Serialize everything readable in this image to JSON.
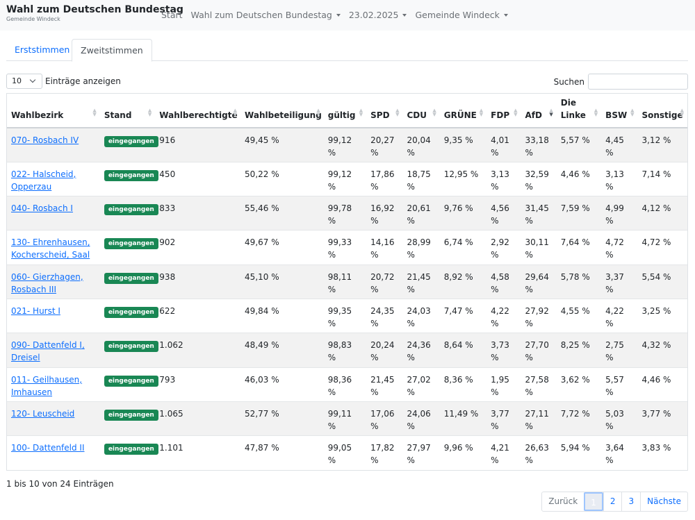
{
  "navbar": {
    "title": "Wahl zum Deutschen Bundestag",
    "subtitle": "Gemeinde Windeck",
    "links": [
      "Start",
      "Wahl zum Deutschen Bundestag",
      "23.02.2025",
      "Gemeinde Windeck"
    ]
  },
  "tabs": [
    "Erststimmen",
    "Zweitstimmen"
  ],
  "active_tab": "Zweitstimmen",
  "length_control": {
    "value": "10",
    "label": "Einträge anzeigen"
  },
  "search": {
    "label": "Suchen",
    "value": ""
  },
  "table": {
    "columns": [
      "Wahlbezirk",
      "Stand",
      "Wahlberechtigte",
      "Wahlbeteiligung",
      "gültig",
      "SPD",
      "CDU",
      "GRÜNE",
      "FDP",
      "AfD",
      "Die Linke",
      "BSW",
      "Sonstige"
    ],
    "sorted_column": "AfD",
    "sort_direction": "descending",
    "rows": [
      {
        "bezirk": "070- Rosbach IV",
        "stand": "eingegangen",
        "berechtigte": "916",
        "beteiligung": "49,45 %",
        "gueltig": "99,12 %",
        "spd": "20,27 %",
        "cdu": "20,04 %",
        "gruene": "9,35 %",
        "fdp": "4,01 %",
        "afd": "33,18 %",
        "linke": "5,57 %",
        "bsw": "4,45 %",
        "sonstige": "3,12 %"
      },
      {
        "bezirk": "022- Halscheid, Opperzau",
        "stand": "eingegangen",
        "berechtigte": "450",
        "beteiligung": "50,22 %",
        "gueltig": "99,12 %",
        "spd": "17,86 %",
        "cdu": "18,75 %",
        "gruene": "12,95 %",
        "fdp": "3,13 %",
        "afd": "32,59 %",
        "linke": "4,46 %",
        "bsw": "3,13 %",
        "sonstige": "7,14 %"
      },
      {
        "bezirk": "040- Rosbach I",
        "stand": "eingegangen",
        "berechtigte": "833",
        "beteiligung": "55,46 %",
        "gueltig": "99,78 %",
        "spd": "16,92 %",
        "cdu": "20,61 %",
        "gruene": "9,76 %",
        "fdp": "4,56 %",
        "afd": "31,45 %",
        "linke": "7,59 %",
        "bsw": "4,99 %",
        "sonstige": "4,12 %"
      },
      {
        "bezirk": "130- Ehrenhausen, Kocherscheid, Saal",
        "stand": "eingegangen",
        "berechtigte": "902",
        "beteiligung": "49,67 %",
        "gueltig": "99,33 %",
        "spd": "14,16 %",
        "cdu": "28,99 %",
        "gruene": "6,74 %",
        "fdp": "2,92 %",
        "afd": "30,11 %",
        "linke": "7,64 %",
        "bsw": "4,72 %",
        "sonstige": "4,72 %"
      },
      {
        "bezirk": "060- Gierzhagen, Rosbach III",
        "stand": "eingegangen",
        "berechtigte": "938",
        "beteiligung": "45,10 %",
        "gueltig": "98,11 %",
        "spd": "20,72 %",
        "cdu": "21,45 %",
        "gruene": "8,92 %",
        "fdp": "4,58 %",
        "afd": "29,64 %",
        "linke": "5,78 %",
        "bsw": "3,37 %",
        "sonstige": "5,54 %"
      },
      {
        "bezirk": "021- Hurst I",
        "stand": "eingegangen",
        "berechtigte": "622",
        "beteiligung": "49,84 %",
        "gueltig": "99,35 %",
        "spd": "24,35 %",
        "cdu": "24,03 %",
        "gruene": "7,47 %",
        "fdp": "4,22 %",
        "afd": "27,92 %",
        "linke": "4,55 %",
        "bsw": "4,22 %",
        "sonstige": "3,25 %"
      },
      {
        "bezirk": "090- Dattenfeld I, Dreisel",
        "stand": "eingegangen",
        "berechtigte": "1.062",
        "beteiligung": "48,49 %",
        "gueltig": "98,83 %",
        "spd": "20,24 %",
        "cdu": "24,36 %",
        "gruene": "8,64 %",
        "fdp": "3,73 %",
        "afd": "27,70 %",
        "linke": "8,25 %",
        "bsw": "2,75 %",
        "sonstige": "4,32 %"
      },
      {
        "bezirk": "011- Geilhausen, Imhausen",
        "stand": "eingegangen",
        "berechtigte": "793",
        "beteiligung": "46,03 %",
        "gueltig": "98,36 %",
        "spd": "21,45 %",
        "cdu": "27,02 %",
        "gruene": "8,36 %",
        "fdp": "1,95 %",
        "afd": "27,58 %",
        "linke": "3,62 %",
        "bsw": "5,57 %",
        "sonstige": "4,46 %"
      },
      {
        "bezirk": "120- Leuscheid",
        "stand": "eingegangen",
        "berechtigte": "1.065",
        "beteiligung": "52,77 %",
        "gueltig": "99,11 %",
        "spd": "17,06 %",
        "cdu": "24,06 %",
        "gruene": "11,49 %",
        "fdp": "3,77 %",
        "afd": "27,11 %",
        "linke": "7,72 %",
        "bsw": "5,03 %",
        "sonstige": "3,77 %"
      },
      {
        "bezirk": "100- Dattenfeld II",
        "stand": "eingegangen",
        "berechtigte": "1.101",
        "beteiligung": "47,87 %",
        "gueltig": "99,05 %",
        "spd": "17,82 %",
        "cdu": "27,97 %",
        "gruene": "9,96 %",
        "fdp": "4,21 %",
        "afd": "26,63 %",
        "linke": "5,94 %",
        "bsw": "3,64 %",
        "sonstige": "3,83 %"
      }
    ]
  },
  "info_text": "1 bis 10 von 24 Einträgen",
  "pagination": {
    "prev": "Zurück",
    "pages": [
      "1",
      "2",
      "3"
    ],
    "active_page": "1",
    "next": "Nächste"
  },
  "colors": {
    "link": "#0d6efd",
    "badge": "#198754",
    "stripe": "#f2f2f2",
    "navbar_bg": "#f8f9fa"
  }
}
